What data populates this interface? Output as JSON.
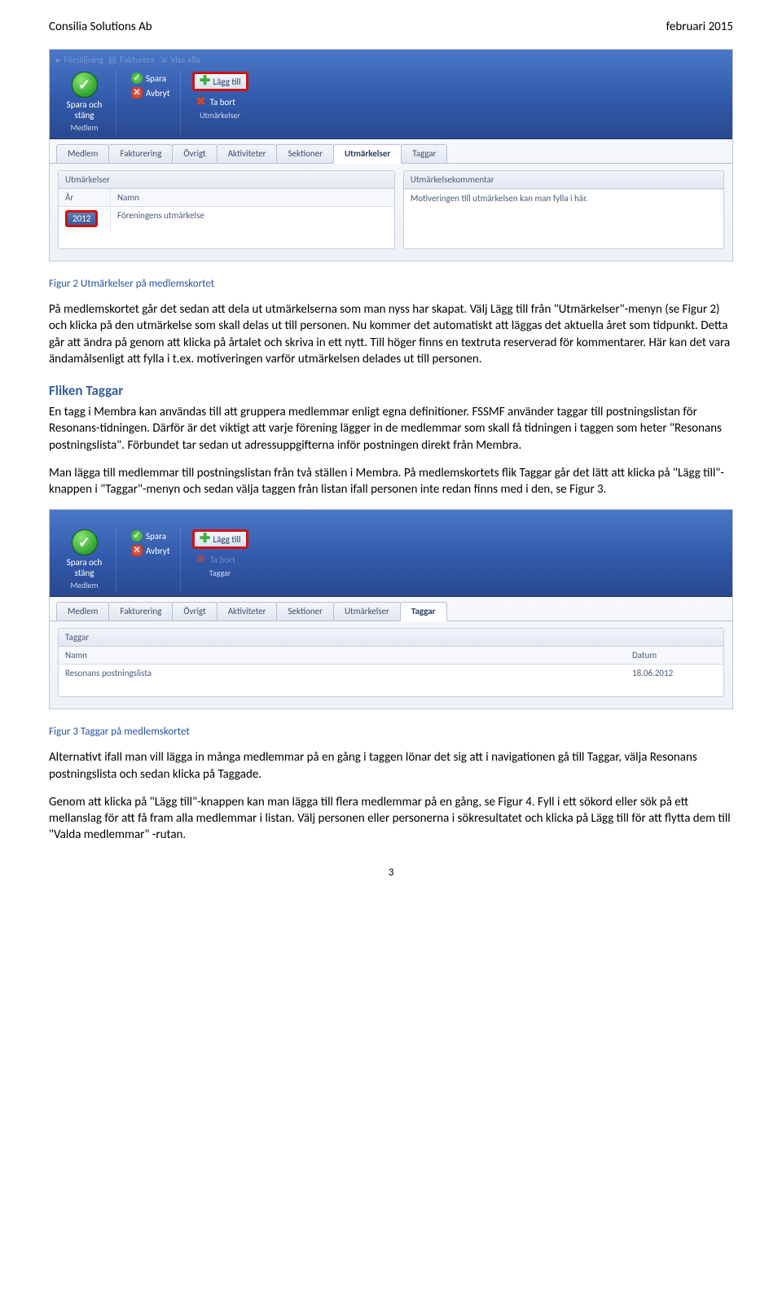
{
  "header": {
    "left": "Consilia Solutions Ab",
    "right": "februari 2015"
  },
  "fig2": {
    "ribbon": {
      "nav_sell": "Försäljning",
      "nav_fakt": "Fakturera",
      "nav_visa": "Visa alla",
      "save_close": "Spara och stäng",
      "spara": "Spara",
      "avbryt": "Avbryt",
      "lagg_till": "Lägg till",
      "ta_bort": "Ta bort",
      "grp_medlem": "Medlem",
      "grp_utm": "Utmärkelser"
    },
    "tabs": [
      "Medlem",
      "Fakturering",
      "Övrigt",
      "Aktiviteter",
      "Sektioner",
      "Utmärkelser",
      "Taggar"
    ],
    "active_tab": "Utmärkelser",
    "left_panel": {
      "title": "Utmärkelser",
      "col_year": "År",
      "col_name": "Namn",
      "row_year": "2012",
      "row_name": "Föreningens utmärkelse"
    },
    "right_panel": {
      "title": "Utmärkelsekommentar",
      "comment": "Motiveringen till utmärkelsen kan man fylla i här."
    }
  },
  "cap2": "Figur 2 Utmärkelser på medlemskortet",
  "p1": "På medlemskortet går det sedan att dela ut utmärkelserna som man nyss har skapat. Välj Lägg till från \"Utmärkelser\"-menyn (se Figur 2) och klicka på den utmärkelse som skall delas ut till personen. Nu kommer det automatiskt att läggas det aktuella året som tidpunkt. Detta går att ändra på genom att klicka på årtalet och skriva in ett nytt. Till höger finns en textruta reserverad för kommentarer. Här kan det vara ändamålsenligt att fylla i t.ex. motiveringen varför utmärkelsen delades ut till personen.",
  "h_taggar": "Fliken Taggar",
  "p2": "En tagg i Membra kan användas till att gruppera medlemmar enligt egna definitioner. FSSMF använder taggar till postningslistan för Resonans-tidningen. Därför är det viktigt att varje förening lägger in de medlemmar som skall få tidningen i taggen som heter \"Resonans postningslista\". Förbundet tar sedan ut adressuppgifterna inför postningen direkt från Membra.",
  "p3": "Man lägga till medlemmar till postningslistan från två ställen i Membra. På medlemskortets flik Taggar går det lätt att klicka på \"Lägg till\"-knappen i \"Taggar\"-menyn och sedan välja taggen från listan ifall personen inte redan finns med i den, se Figur 3.",
  "fig3": {
    "ribbon": {
      "save_close": "Spara och stäng",
      "spara": "Spara",
      "avbryt": "Avbryt",
      "lagg_till": "Lägg till",
      "ta_bort": "Ta bort",
      "grp_medlem": "Medlem",
      "grp_taggar": "Taggar"
    },
    "tabs": [
      "Medlem",
      "Fakturering",
      "Övrigt",
      "Aktiviteter",
      "Sektioner",
      "Utmärkelser",
      "Taggar"
    ],
    "active_tab": "Taggar",
    "panel": {
      "title": "Taggar",
      "col_name": "Namn",
      "col_date": "Datum",
      "row_name": "Resonans postningslista",
      "row_date": "18.06.2012"
    }
  },
  "cap3": "Figur 3 Taggar på medlemskortet",
  "p4": "Alternativt ifall man vill lägga in många medlemmar på en gång i taggen lönar det sig att i navigationen gå till Taggar, välja Resonans postningslista och sedan klicka på Taggade.",
  "p5": "Genom att klicka på \"Lägg till\"-knappen kan man lägga till flera medlemmar på en gång, se Figur 4. Fyll i ett sökord eller sök på ett mellanslag för att få fram alla medlemmar i listan. Välj personen eller personerna i sökresultatet och klicka på Lägg till för att flytta dem till \"Valda medlemmar\" -rutan.",
  "page": "3"
}
